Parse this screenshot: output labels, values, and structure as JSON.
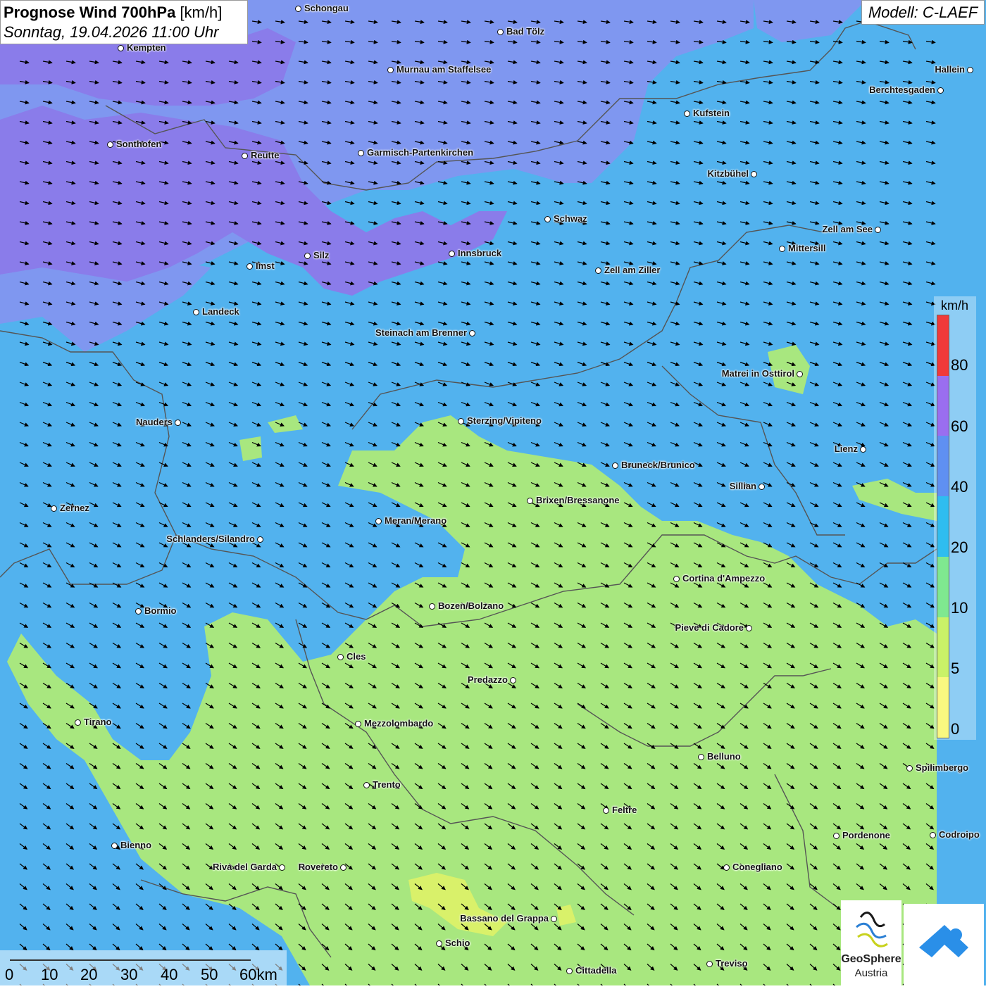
{
  "header": {
    "title_bold": "Prognose Wind 700hPa",
    "title_unit": "[km/h]",
    "subtitle": "Sonntag, 19.04.2026 11:00 Uhr",
    "model": "Modell: C-LAEF"
  },
  "legend": {
    "unit": "km/h",
    "ticks": [
      "80",
      "60",
      "40",
      "20",
      "10",
      "5",
      "0"
    ],
    "colors": [
      "#f03a3a",
      "#9a6ef0",
      "#5f90f2",
      "#2fbdf0",
      "#7fe890",
      "#c9f268",
      "#f9f880"
    ]
  },
  "scalebar": {
    "labels": [
      "0",
      "10",
      "20",
      "30",
      "40",
      "50",
      "60km"
    ]
  },
  "logos": {
    "geosphere_line1": "GeoSphere",
    "geosphere_line2": "Austria",
    "geosphere_icon": "geosphere-logo-icon",
    "brand_icon": "cloud-mountain-logo-icon"
  },
  "map_colors": {
    "wind_40_60": "#7f97f0",
    "wind_20_40": "#52b2ee",
    "wind_10_20": "#a8e77f",
    "wind_5_10": "#d9f16a",
    "wind_60_80": "#8a7cea",
    "borders": "#555555"
  },
  "cities": [
    {
      "name": "Schongau"
    },
    {
      "name": "Bad Tölz"
    },
    {
      "name": "Kempten"
    },
    {
      "name": "Murnau am Staffelsee"
    },
    {
      "name": "Hallein"
    },
    {
      "name": "Berchtesgaden"
    },
    {
      "name": "Kufstein"
    },
    {
      "name": "Sonthofen"
    },
    {
      "name": "Reutte"
    },
    {
      "name": "Garmisch-Partenkirchen"
    },
    {
      "name": "Kitzbühel"
    },
    {
      "name": "Schwaz"
    },
    {
      "name": "Zell am See"
    },
    {
      "name": "Mittersill"
    },
    {
      "name": "Silz"
    },
    {
      "name": "Innsbruck"
    },
    {
      "name": "Imst"
    },
    {
      "name": "Zell am Ziller"
    },
    {
      "name": "Landeck"
    },
    {
      "name": "Steinach am Brenner"
    },
    {
      "name": "Matrei in Osttirol"
    },
    {
      "name": "Nauders"
    },
    {
      "name": "Sterzing/Vipiteno"
    },
    {
      "name": "Lienz"
    },
    {
      "name": "Bruneck/Brunico"
    },
    {
      "name": "Sillian"
    },
    {
      "name": "Zernez"
    },
    {
      "name": "Brixen/Bressanone"
    },
    {
      "name": "Meran/Merano"
    },
    {
      "name": "Schlanders/Silandro"
    },
    {
      "name": "Cortina d'Ampezzo"
    },
    {
      "name": "Bormio"
    },
    {
      "name": "Bozen/Bolzano"
    },
    {
      "name": "Pieve di Cadore"
    },
    {
      "name": "Cles"
    },
    {
      "name": "Predazzo"
    },
    {
      "name": "Tirano"
    },
    {
      "name": "Mezzolombardo"
    },
    {
      "name": "Belluno"
    },
    {
      "name": "Spilimbergo"
    },
    {
      "name": "Trento"
    },
    {
      "name": "Feltre"
    },
    {
      "name": "Pordenone"
    },
    {
      "name": "Codroipo"
    },
    {
      "name": "Bienno"
    },
    {
      "name": "Riva del Garda"
    },
    {
      "name": "Rovereto"
    },
    {
      "name": "Conegliano"
    },
    {
      "name": "Bassano del Grappa"
    },
    {
      "name": "Schio"
    },
    {
      "name": "Treviso"
    },
    {
      "name": "Cittadella"
    }
  ]
}
